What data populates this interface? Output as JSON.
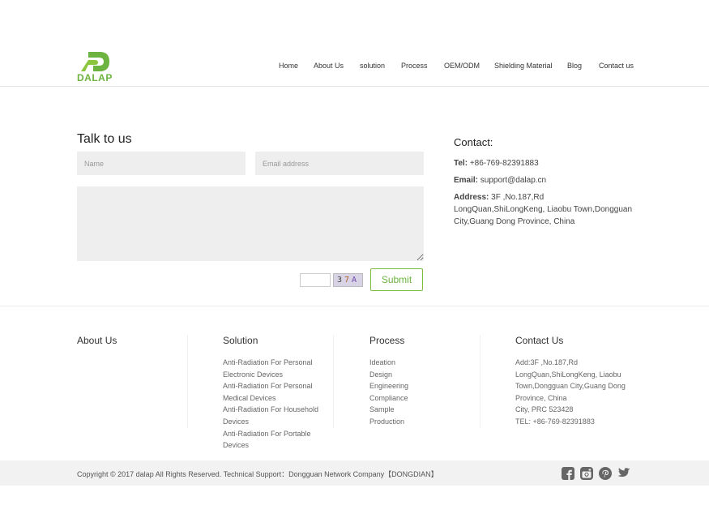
{
  "brand": {
    "logo_text": "DALAP",
    "accent_color": "#6db33f"
  },
  "nav": [
    {
      "label": "Home"
    },
    {
      "label": "About Us"
    },
    {
      "label": "solution"
    },
    {
      "label": "Process"
    },
    {
      "label": "OEM/ODM"
    },
    {
      "label": "Shielding Material"
    },
    {
      "label": "Blog"
    },
    {
      "label": "Contact us"
    }
  ],
  "talk": {
    "title": "Talk to us",
    "name_placeholder": "Name",
    "email_placeholder": "Email address",
    "captcha_text": [
      "3",
      "7",
      "A"
    ],
    "submit_label": "Submit"
  },
  "contact": {
    "title": "Contact:",
    "tel_label": "Tel:",
    "tel_value": "+86-769-82391883",
    "email_label": "Email:",
    "email_value": "support@dalap.cn",
    "address_label": "Address:",
    "address_value": "3F ,No.187,Rd LongQuan,ShiLongKeng, Liaobu Town,Dongguan City,Guang Dong Province, China"
  },
  "footer": {
    "about_title": "About Us",
    "solution_title": "Solution",
    "solution_items": [
      "Anti-Radiation For Personal Electronic Devices",
      "Anti-Radiation For Personal Medical Devices",
      "Anti-Radiation For Household Devices",
      "Anti-Radiation For Portable Devices"
    ],
    "process_title": "Process",
    "process_items": [
      "Ideation",
      "Design",
      "Engineering",
      "Compliance",
      "Sample",
      "Production"
    ],
    "contact_title": "Contact Us",
    "contact_lines": [
      "Add:3F ,No.187,Rd LongQuan,ShiLongKeng, Liaobu Town,Dongguan City,Guang Dong Province, China",
      "City, PRC 523428",
      "TEL: +86-769-82391883"
    ],
    "copyright": "Copyright © 2017 dalap All Rights Reserved. Technical Support：Dongguan Network Company【DONGDIAN】",
    "social_icons": [
      "facebook-icon",
      "instagram-icon",
      "pinterest-icon",
      "twitter-icon"
    ],
    "icon_color": "#666666"
  }
}
